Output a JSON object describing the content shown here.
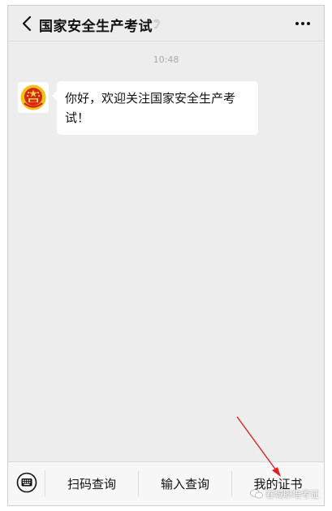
{
  "header": {
    "title": "国家安全生产考试",
    "back_icon": "chevron-left-icon",
    "ear_icon": "ear-icon",
    "more_icon": "more-dots-icon"
  },
  "chat": {
    "timestamp": "10:48",
    "message": "你好，欢迎关注国家安全生产考试！",
    "avatar_icon": "national-emblem-icon"
  },
  "bottom_menu": {
    "keyboard_icon": "keyboard-icon",
    "items": [
      {
        "label": "扫码查询"
      },
      {
        "label": "输入查询"
      },
      {
        "label": "我的证书"
      }
    ]
  },
  "watermark": {
    "text": "春城职培考证"
  },
  "colors": {
    "background": "#ededed",
    "annotation_arrow": "#e02020"
  }
}
